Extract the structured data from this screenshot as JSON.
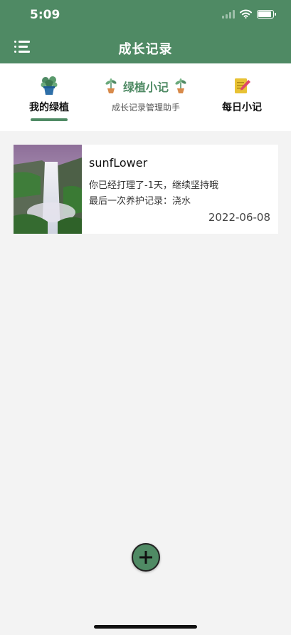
{
  "status": {
    "time": "5:09",
    "battery_level": 0.9
  },
  "header": {
    "title": "成长记录",
    "menu_icon": "list-menu-icon"
  },
  "tabs": [
    {
      "label": "我的绿植",
      "icon": "potted-plant-icon",
      "active": true
    },
    {
      "label": "每日小记",
      "icon": "notepad-pencil-icon",
      "active": false
    }
  ],
  "brand": {
    "title": "绿植小记",
    "subtitle": "成长记录管理助手",
    "icon": "sprout-icon"
  },
  "plants": [
    {
      "name": "sunfLower",
      "care_days_text": "你已经打理了-1天，继续坚持哦",
      "last_record_text": "最后一次养护记录：浇水",
      "date": "2022-06-08",
      "image": "waterfall-photo"
    }
  ],
  "fab": {
    "icon": "plus-icon"
  },
  "colors": {
    "primary": "#4f8a64",
    "background": "#f3f3f3"
  }
}
